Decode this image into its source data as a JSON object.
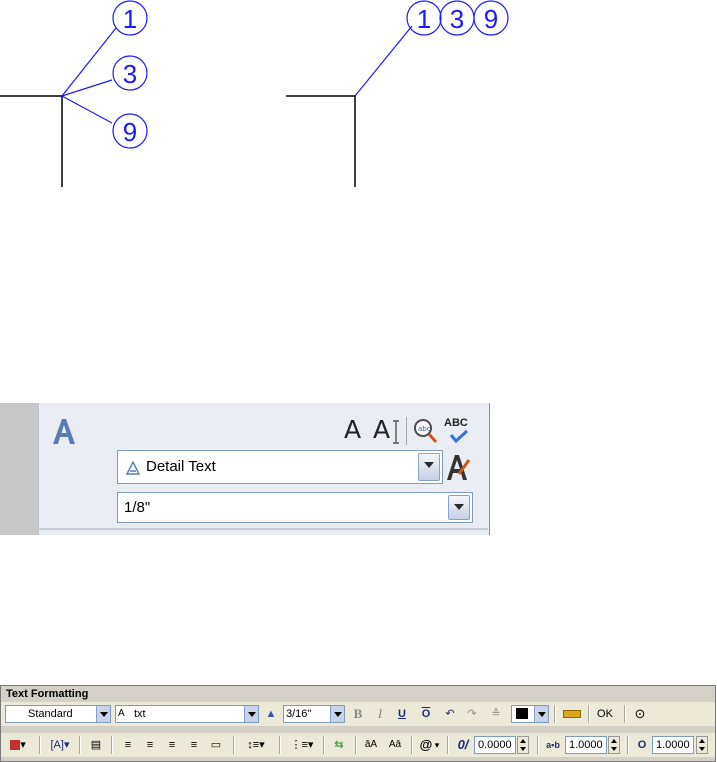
{
  "colors": {
    "leader_blue": "#1a1aff",
    "line_black": "#000000",
    "panel_bg": "#eaedf3",
    "toolbar_bg": "#ece9d8"
  },
  "drawing": {
    "left_example_keynotes": [
      "1",
      "3",
      "9"
    ],
    "right_example_keynotes": [
      "1",
      "3",
      "9"
    ]
  },
  "text_panel": {
    "style_select": {
      "value": "Detail Text"
    },
    "height_select": {
      "value": "1/8\""
    },
    "icons": [
      "text-style-icon",
      "multiline-text-icon",
      "single-line-text-icon",
      "find-replace-icon",
      "spell-check-icon",
      "text-style-manager-icon"
    ],
    "spell_label": "ABC"
  },
  "text_formatting": {
    "title": "Text Formatting",
    "style_select": "Standard",
    "font_select": "txt",
    "height_select": "3/16\"",
    "bold": "B",
    "italic": "I",
    "underline": "U",
    "overline": "O",
    "ok_label": "OK",
    "oblique_value": "0.0000",
    "tracking_value": "1.0000",
    "width_value": "1.0000",
    "upper_label": "āA",
    "lower_label": "Aā",
    "symbol_label": "@",
    "oblique_label": "0/",
    "tracking_label": "a•b",
    "width_label": "O"
  }
}
